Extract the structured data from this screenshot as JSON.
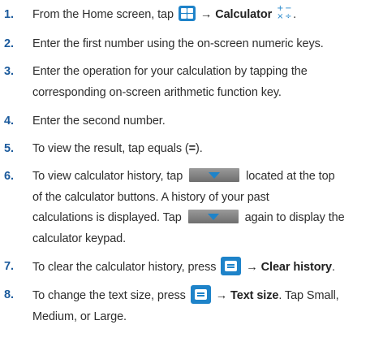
{
  "icons": {
    "apps": "apps-grid-icon",
    "calculator": "calculator-app-icon",
    "down_arrow": "down-arrow-button-icon",
    "menu": "menu-key-icon",
    "accent": "#1e83c9",
    "step_number_color": "#1b5a9c"
  },
  "steps": [
    {
      "number": "1.",
      "pre": "From the Home screen, tap",
      "arrow": "→",
      "bold": "Calculator",
      "post": "."
    },
    {
      "number": "2.",
      "text": "Enter the first number using the on-screen numeric keys."
    },
    {
      "number": "3.",
      "line1": "Enter the operation for your calculation by tapping the",
      "line2": "corresponding on-screen arithmetic function key."
    },
    {
      "number": "4.",
      "text": "Enter the second number."
    },
    {
      "number": "5.",
      "pre": "To view the result, tap equals (",
      "bold": "=",
      "post": ")."
    },
    {
      "number": "6.",
      "line1_pre": "To view calculator history, tap",
      "line1_post": "located at the top",
      "line2": "of the calculator buttons. A history of your past",
      "line3_pre": "calculations is displayed. Tap",
      "line3_post": "again to display the",
      "line4": "calculator keypad."
    },
    {
      "number": "7.",
      "pre": "To clear the calculator history, press",
      "arrow": "→",
      "bold": "Clear history",
      "post": "."
    },
    {
      "number": "8.",
      "line1_pre": "To change the text size, press",
      "arrow": "→",
      "bold": "Text size",
      "line1_post": ". Tap Small,",
      "line2": "Medium, or Large."
    }
  ]
}
